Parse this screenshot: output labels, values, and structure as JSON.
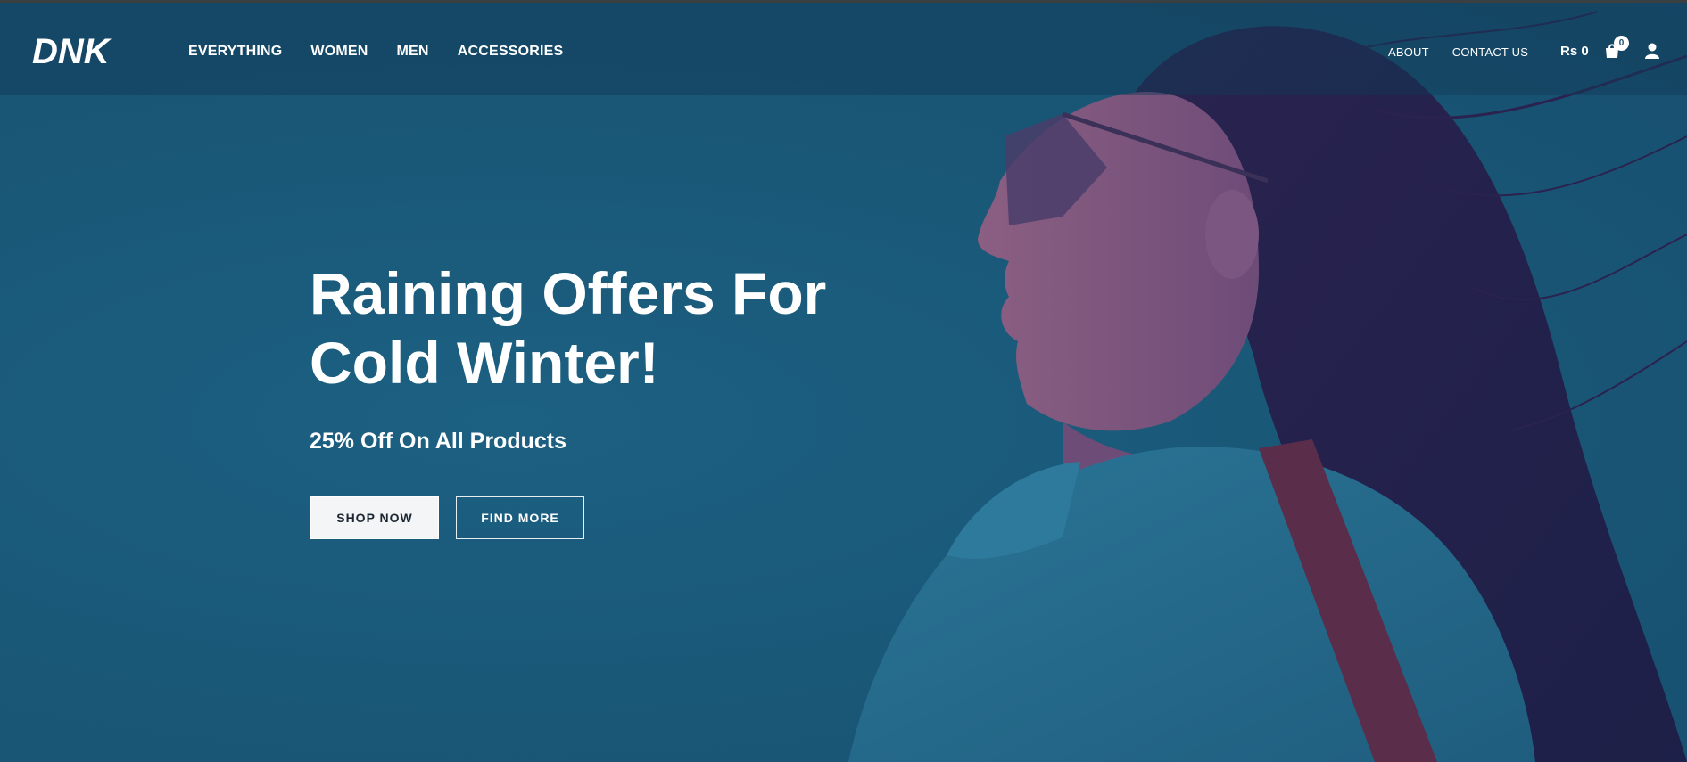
{
  "brand": {
    "logo_text": "DNK"
  },
  "nav": {
    "main": [
      {
        "label": "EVERYTHING"
      },
      {
        "label": "WOMEN"
      },
      {
        "label": "MEN"
      },
      {
        "label": "ACCESSORIES"
      }
    ],
    "secondary": [
      {
        "label": "ABOUT"
      },
      {
        "label": "CONTACT US"
      }
    ]
  },
  "cart": {
    "total": "Rs 0",
    "count": "0",
    "icon": "shopping-bag-icon"
  },
  "account": {
    "icon": "user-icon"
  },
  "hero": {
    "headline": "Raining Offers For Cold Winter!",
    "subhead": "25% Off On All Products",
    "primary_cta": "SHOP NOW",
    "secondary_cta": "FIND MORE"
  },
  "colors": {
    "background": "#1b5a7a",
    "header_overlay": "#113a56",
    "text": "#ffffff",
    "button_light": "#f4f5f7"
  }
}
